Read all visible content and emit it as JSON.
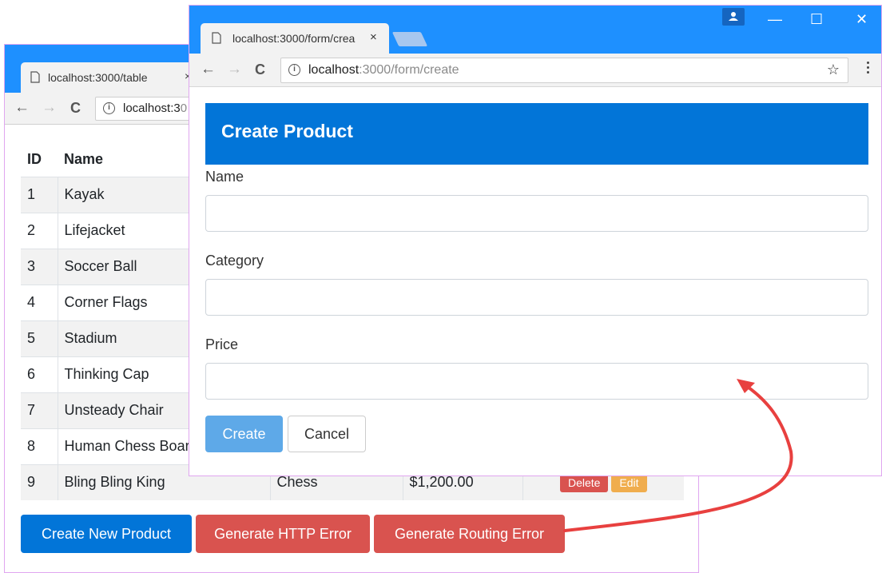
{
  "back_window": {
    "tab_title": "localhost:3000/table",
    "tab_close": "×",
    "url_host": "localhost:3",
    "url_path": "0",
    "nav": {
      "back": "←",
      "forward": "→",
      "reload": "C",
      "info": "i"
    },
    "table": {
      "headers": [
        "ID",
        "Name"
      ],
      "rows": [
        {
          "id": "1",
          "name": "Kayak",
          "category": "",
          "price": ""
        },
        {
          "id": "2",
          "name": "Lifejacket",
          "category": "",
          "price": ""
        },
        {
          "id": "3",
          "name": "Soccer Ball",
          "category": "",
          "price": ""
        },
        {
          "id": "4",
          "name": "Corner Flags",
          "category": "",
          "price": ""
        },
        {
          "id": "5",
          "name": "Stadium",
          "category": "",
          "price": ""
        },
        {
          "id": "6",
          "name": "Thinking Cap",
          "category": "",
          "price": ""
        },
        {
          "id": "7",
          "name": "Unsteady Chair",
          "category": "",
          "price": ""
        },
        {
          "id": "8",
          "name": "Human Chess Boar",
          "category": "",
          "price": ""
        },
        {
          "id": "9",
          "name": "Bling Bling King",
          "category": "Chess",
          "price": "$1,200.00"
        }
      ],
      "delete_label": "Delete",
      "edit_label": "Edit"
    },
    "buttons": {
      "create_new": "Create New Product",
      "http_error": "Generate HTTP Error",
      "routing_error": "Generate Routing Error"
    },
    "colors": {
      "titlebar": "#1e90ff",
      "primary": "#0275d8",
      "danger": "#d9534f",
      "warning": "#f0ad4e"
    }
  },
  "front_window": {
    "tab_title": "localhost:3000/form/crea",
    "tab_close": "×",
    "url_host": "localhost",
    "url_path": ":3000/form/create",
    "nav": {
      "back": "←",
      "forward": "→",
      "reload": "C",
      "info": "i",
      "star": "☆"
    },
    "window_controls": {
      "minimize": "—",
      "maximize": "☐",
      "close": "✕"
    },
    "form": {
      "title": "Create Product",
      "fields": [
        {
          "label": "Name",
          "value": ""
        },
        {
          "label": "Category",
          "value": ""
        },
        {
          "label": "Price",
          "value": ""
        }
      ],
      "create_label": "Create",
      "cancel_label": "Cancel"
    },
    "colors": {
      "header": "#0275d8",
      "create_button": "#5ea9e8"
    }
  },
  "annotation": {
    "arrow_color": "#e8403f"
  }
}
